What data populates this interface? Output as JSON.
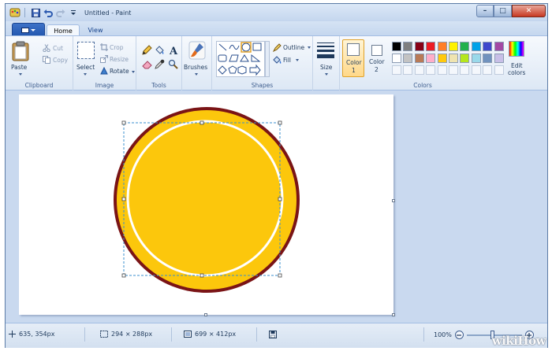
{
  "window": {
    "title": "Untitled - Paint",
    "controls": {
      "minimize": "–",
      "maximize": "□",
      "close": "✕"
    }
  },
  "tabs": {
    "home": "Home",
    "view": "View"
  },
  "ribbon": {
    "clipboard": {
      "label": "Clipboard",
      "paste": "Paste",
      "cut": "Cut",
      "copy": "Copy"
    },
    "image": {
      "label": "Image",
      "select": "Select",
      "crop": "Crop",
      "resize": "Resize",
      "rotate": "Rotate"
    },
    "tools": {
      "label": "Tools"
    },
    "brushes": "Brushes",
    "shapes": {
      "label": "Shapes",
      "outline": "Outline",
      "fill": "Fill"
    },
    "size": "Size",
    "colors": {
      "label": "Colors",
      "color1": "Color",
      "color1_num": "1",
      "color2": "Color",
      "color2_num": "2",
      "edit_colors_1": "Edit",
      "edit_colors_2": "colors",
      "color1_value": "#ffffff",
      "color2_value": "#ffffff",
      "palette_row1": [
        "#000000",
        "#7f7f7f",
        "#880015",
        "#ed1c24",
        "#ff7f27",
        "#fff200",
        "#22b14c",
        "#00a2e8",
        "#3f48cc",
        "#a349a4"
      ],
      "palette_row2": [
        "#ffffff",
        "#c3c3c3",
        "#b97a57",
        "#ffaec9",
        "#ffc90e",
        "#efe4b0",
        "#b5e61d",
        "#99d9ea",
        "#7092be",
        "#c8bfe7"
      ]
    }
  },
  "canvas": {
    "circle_fill": "#fcc70c",
    "circle_outline": "#7a1416",
    "inner_ring": "#ffffff"
  },
  "status": {
    "cursor_pos": "635, 354px",
    "selection_size": "294 × 288px",
    "image_size": "699 × 412px",
    "zoom": "100%"
  },
  "watermark": "wikiHow"
}
